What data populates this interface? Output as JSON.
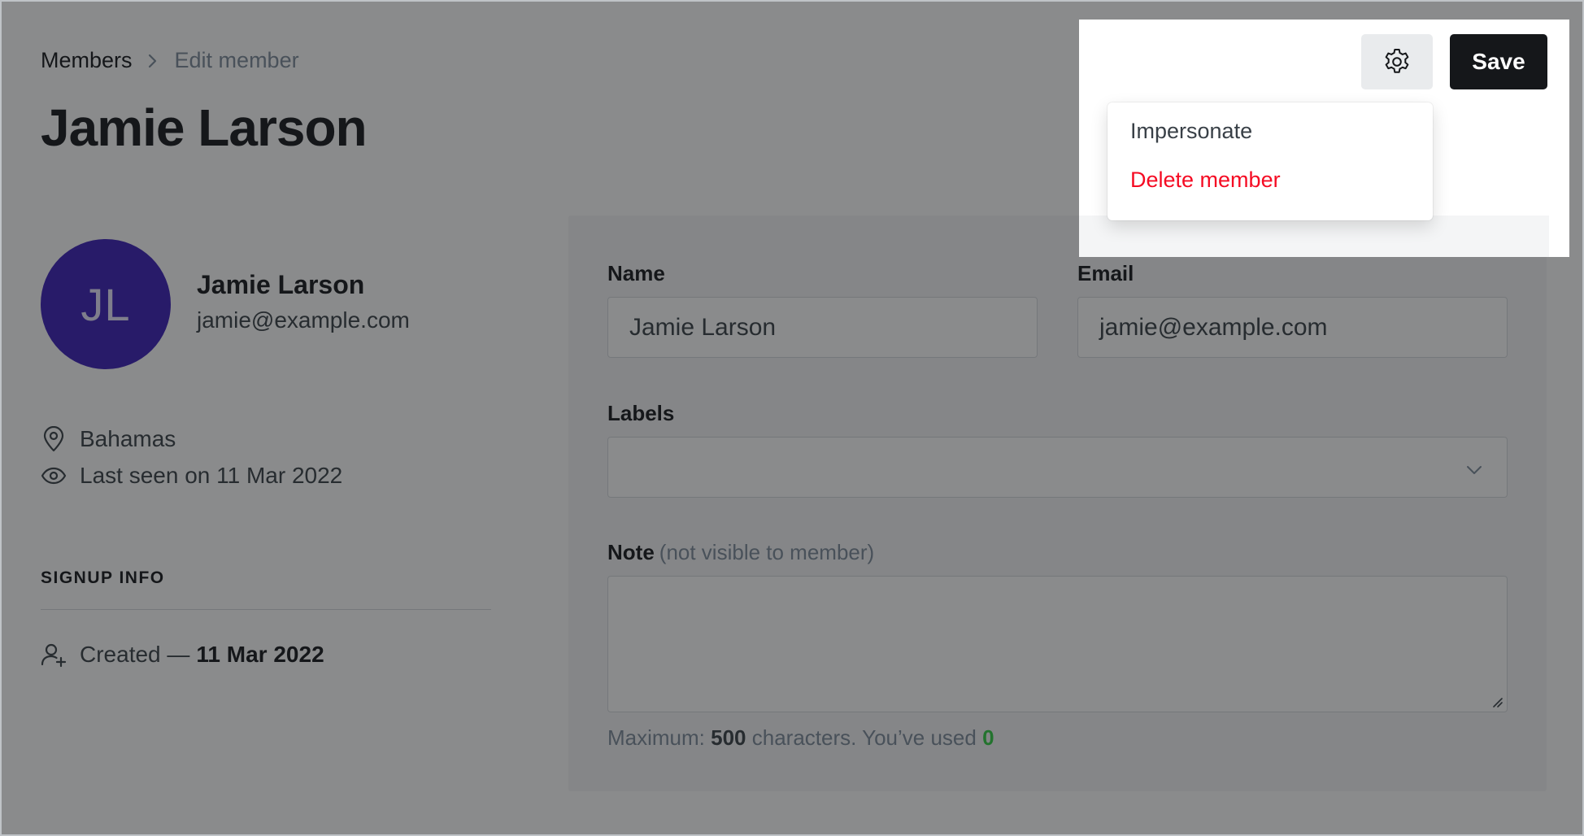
{
  "breadcrumb": {
    "parent": "Members",
    "current": "Edit member"
  },
  "page_title": "Jamie Larson",
  "member": {
    "initials": "JL",
    "name": "Jamie Larson",
    "email": "jamie@example.com",
    "location": "Bahamas",
    "last_seen": "Last seen on 11 Mar 2022"
  },
  "signup_info": {
    "title": "SIGNUP INFO",
    "created_label": "Created —",
    "created_date": "11 Mar 2022"
  },
  "form": {
    "name_label": "Name",
    "name_value": "Jamie Larson",
    "email_label": "Email",
    "email_value": "jamie@example.com",
    "labels_label": "Labels",
    "note_label": "Note",
    "note_hint": "(not visible to member)",
    "char_prefix": "Maximum:",
    "char_max": "500",
    "char_middle": "characters. You’ve used",
    "char_used": "0"
  },
  "toolbar": {
    "save_label": "Save",
    "settings_icon": "gear-icon"
  },
  "dropdown_menu": {
    "items": [
      {
        "label": "Impersonate",
        "color": "#394047"
      },
      {
        "label": "Delete member",
        "color": "#f50b23"
      }
    ]
  },
  "colors": {
    "avatar_bg": "#3a1fb8",
    "accent_green": "#30cf43",
    "danger_red": "#f50b23",
    "primary_dark": "#15171a"
  }
}
